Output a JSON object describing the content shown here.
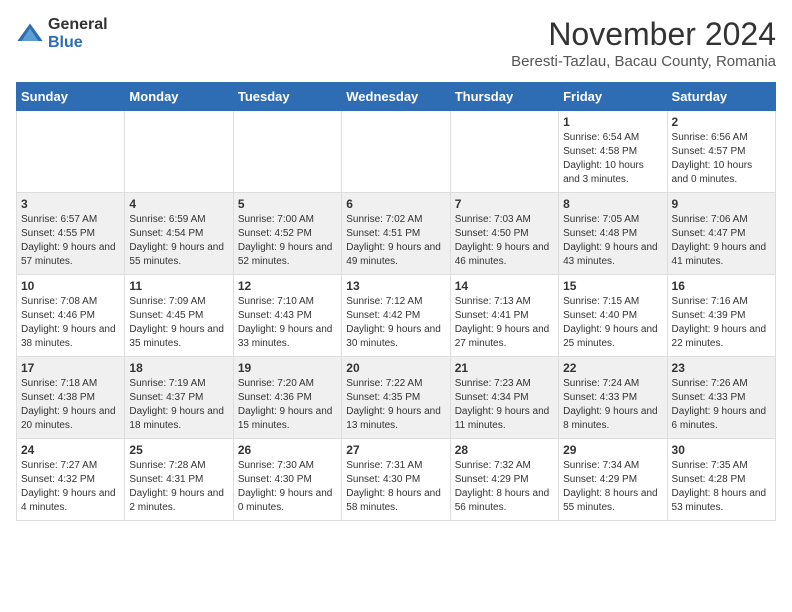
{
  "header": {
    "logo_general": "General",
    "logo_blue": "Blue",
    "month_title": "November 2024",
    "location": "Beresti-Tazlau, Bacau County, Romania"
  },
  "days_of_week": [
    "Sunday",
    "Monday",
    "Tuesday",
    "Wednesday",
    "Thursday",
    "Friday",
    "Saturday"
  ],
  "weeks": [
    [
      {
        "day": "",
        "detail": ""
      },
      {
        "day": "",
        "detail": ""
      },
      {
        "day": "",
        "detail": ""
      },
      {
        "day": "",
        "detail": ""
      },
      {
        "day": "",
        "detail": ""
      },
      {
        "day": "1",
        "detail": "Sunrise: 6:54 AM\nSunset: 4:58 PM\nDaylight: 10 hours and 3 minutes."
      },
      {
        "day": "2",
        "detail": "Sunrise: 6:56 AM\nSunset: 4:57 PM\nDaylight: 10 hours and 0 minutes."
      }
    ],
    [
      {
        "day": "3",
        "detail": "Sunrise: 6:57 AM\nSunset: 4:55 PM\nDaylight: 9 hours and 57 minutes."
      },
      {
        "day": "4",
        "detail": "Sunrise: 6:59 AM\nSunset: 4:54 PM\nDaylight: 9 hours and 55 minutes."
      },
      {
        "day": "5",
        "detail": "Sunrise: 7:00 AM\nSunset: 4:52 PM\nDaylight: 9 hours and 52 minutes."
      },
      {
        "day": "6",
        "detail": "Sunrise: 7:02 AM\nSunset: 4:51 PM\nDaylight: 9 hours and 49 minutes."
      },
      {
        "day": "7",
        "detail": "Sunrise: 7:03 AM\nSunset: 4:50 PM\nDaylight: 9 hours and 46 minutes."
      },
      {
        "day": "8",
        "detail": "Sunrise: 7:05 AM\nSunset: 4:48 PM\nDaylight: 9 hours and 43 minutes."
      },
      {
        "day": "9",
        "detail": "Sunrise: 7:06 AM\nSunset: 4:47 PM\nDaylight: 9 hours and 41 minutes."
      }
    ],
    [
      {
        "day": "10",
        "detail": "Sunrise: 7:08 AM\nSunset: 4:46 PM\nDaylight: 9 hours and 38 minutes."
      },
      {
        "day": "11",
        "detail": "Sunrise: 7:09 AM\nSunset: 4:45 PM\nDaylight: 9 hours and 35 minutes."
      },
      {
        "day": "12",
        "detail": "Sunrise: 7:10 AM\nSunset: 4:43 PM\nDaylight: 9 hours and 33 minutes."
      },
      {
        "day": "13",
        "detail": "Sunrise: 7:12 AM\nSunset: 4:42 PM\nDaylight: 9 hours and 30 minutes."
      },
      {
        "day": "14",
        "detail": "Sunrise: 7:13 AM\nSunset: 4:41 PM\nDaylight: 9 hours and 27 minutes."
      },
      {
        "day": "15",
        "detail": "Sunrise: 7:15 AM\nSunset: 4:40 PM\nDaylight: 9 hours and 25 minutes."
      },
      {
        "day": "16",
        "detail": "Sunrise: 7:16 AM\nSunset: 4:39 PM\nDaylight: 9 hours and 22 minutes."
      }
    ],
    [
      {
        "day": "17",
        "detail": "Sunrise: 7:18 AM\nSunset: 4:38 PM\nDaylight: 9 hours and 20 minutes."
      },
      {
        "day": "18",
        "detail": "Sunrise: 7:19 AM\nSunset: 4:37 PM\nDaylight: 9 hours and 18 minutes."
      },
      {
        "day": "19",
        "detail": "Sunrise: 7:20 AM\nSunset: 4:36 PM\nDaylight: 9 hours and 15 minutes."
      },
      {
        "day": "20",
        "detail": "Sunrise: 7:22 AM\nSunset: 4:35 PM\nDaylight: 9 hours and 13 minutes."
      },
      {
        "day": "21",
        "detail": "Sunrise: 7:23 AM\nSunset: 4:34 PM\nDaylight: 9 hours and 11 minutes."
      },
      {
        "day": "22",
        "detail": "Sunrise: 7:24 AM\nSunset: 4:33 PM\nDaylight: 9 hours and 8 minutes."
      },
      {
        "day": "23",
        "detail": "Sunrise: 7:26 AM\nSunset: 4:33 PM\nDaylight: 9 hours and 6 minutes."
      }
    ],
    [
      {
        "day": "24",
        "detail": "Sunrise: 7:27 AM\nSunset: 4:32 PM\nDaylight: 9 hours and 4 minutes."
      },
      {
        "day": "25",
        "detail": "Sunrise: 7:28 AM\nSunset: 4:31 PM\nDaylight: 9 hours and 2 minutes."
      },
      {
        "day": "26",
        "detail": "Sunrise: 7:30 AM\nSunset: 4:30 PM\nDaylight: 9 hours and 0 minutes."
      },
      {
        "day": "27",
        "detail": "Sunrise: 7:31 AM\nSunset: 4:30 PM\nDaylight: 8 hours and 58 minutes."
      },
      {
        "day": "28",
        "detail": "Sunrise: 7:32 AM\nSunset: 4:29 PM\nDaylight: 8 hours and 56 minutes."
      },
      {
        "day": "29",
        "detail": "Sunrise: 7:34 AM\nSunset: 4:29 PM\nDaylight: 8 hours and 55 minutes."
      },
      {
        "day": "30",
        "detail": "Sunrise: 7:35 AM\nSunset: 4:28 PM\nDaylight: 8 hours and 53 minutes."
      }
    ]
  ]
}
